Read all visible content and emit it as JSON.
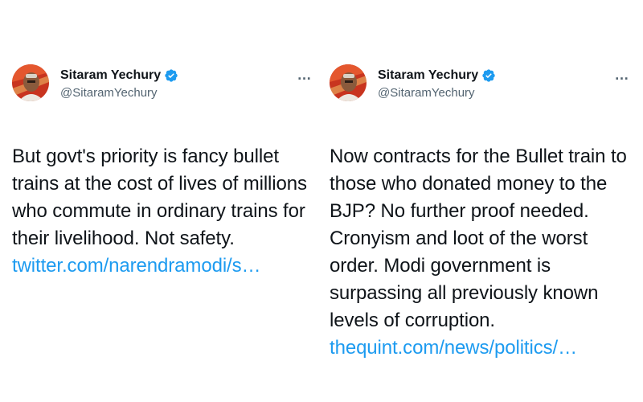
{
  "tweets": [
    {
      "author": {
        "display_name": "Sitaram Yechury",
        "handle": "@SitaramYechury",
        "verified_icon": "verified-badge-icon"
      },
      "text": "But govt's priority is fancy bullet trains at the cost of lives of millions who commute in ordinary trains for their livelihood. Not safety.",
      "link": "twitter.com/narendramodi/s…",
      "more_icon": "…"
    },
    {
      "author": {
        "display_name": "Sitaram Yechury",
        "handle": "@SitaramYechury",
        "verified_icon": "verified-badge-icon"
      },
      "text": "Now contracts for the Bullet train to those who donated money to the BJP? No further proof needed. Cronyism and loot of the worst order. Modi government is surpassing all previously known levels of corruption.",
      "link": "thequint.com/news/politics/…",
      "more_icon": "…"
    }
  ],
  "colors": {
    "link": "#1d9bf0",
    "verified": "#1d9bf0",
    "secondary_text": "#536471",
    "primary_text": "#0f1419"
  }
}
